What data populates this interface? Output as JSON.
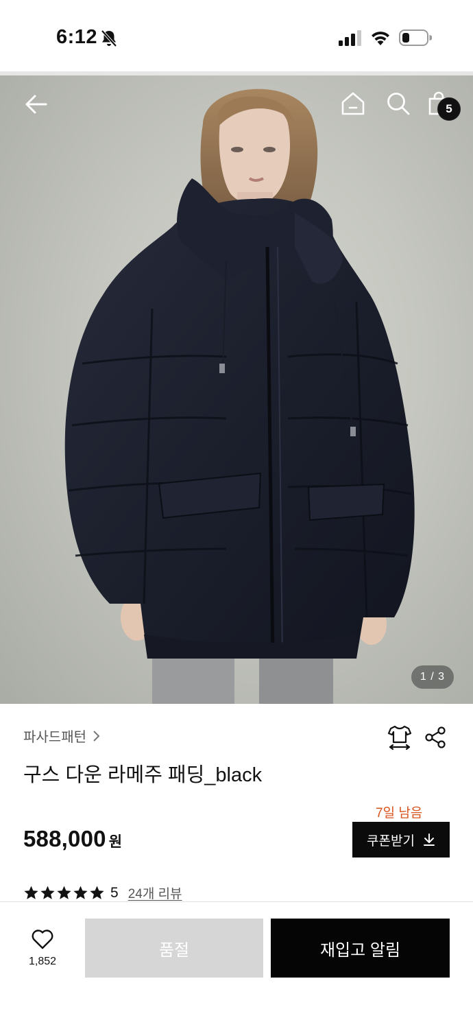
{
  "status_bar": {
    "time": "6:12",
    "icons": [
      "bell-slash-icon",
      "cellular-signal-icon",
      "wifi-icon",
      "battery-icon"
    ]
  },
  "header": {
    "icons": [
      "back-arrow-icon",
      "home-icon",
      "search-icon",
      "shopping-bag-icon"
    ],
    "cart_count": "5"
  },
  "gallery": {
    "page_indicator": "1 / 3",
    "current_page": 1,
    "total_pages": 3
  },
  "product": {
    "brand": "파사드패턴",
    "title": "구스 다운 라메주 패딩_black",
    "price": "588,000",
    "currency": "원",
    "coupon_days_left": "7일 남음",
    "coupon_label": "쿠폰받기",
    "rating_stars": 5,
    "rating_value": "5",
    "review_link": "24개 리뷰",
    "icons": [
      "size-guide-icon",
      "share-icon"
    ]
  },
  "bottom_bar": {
    "wish_count": "1,852",
    "soldout_label": "품절",
    "restock_label": "재입고 알림"
  },
  "colors": {
    "accent_orange": "#d9531e",
    "primary_black": "#050505",
    "disabled_gray": "#d6d6d6"
  }
}
